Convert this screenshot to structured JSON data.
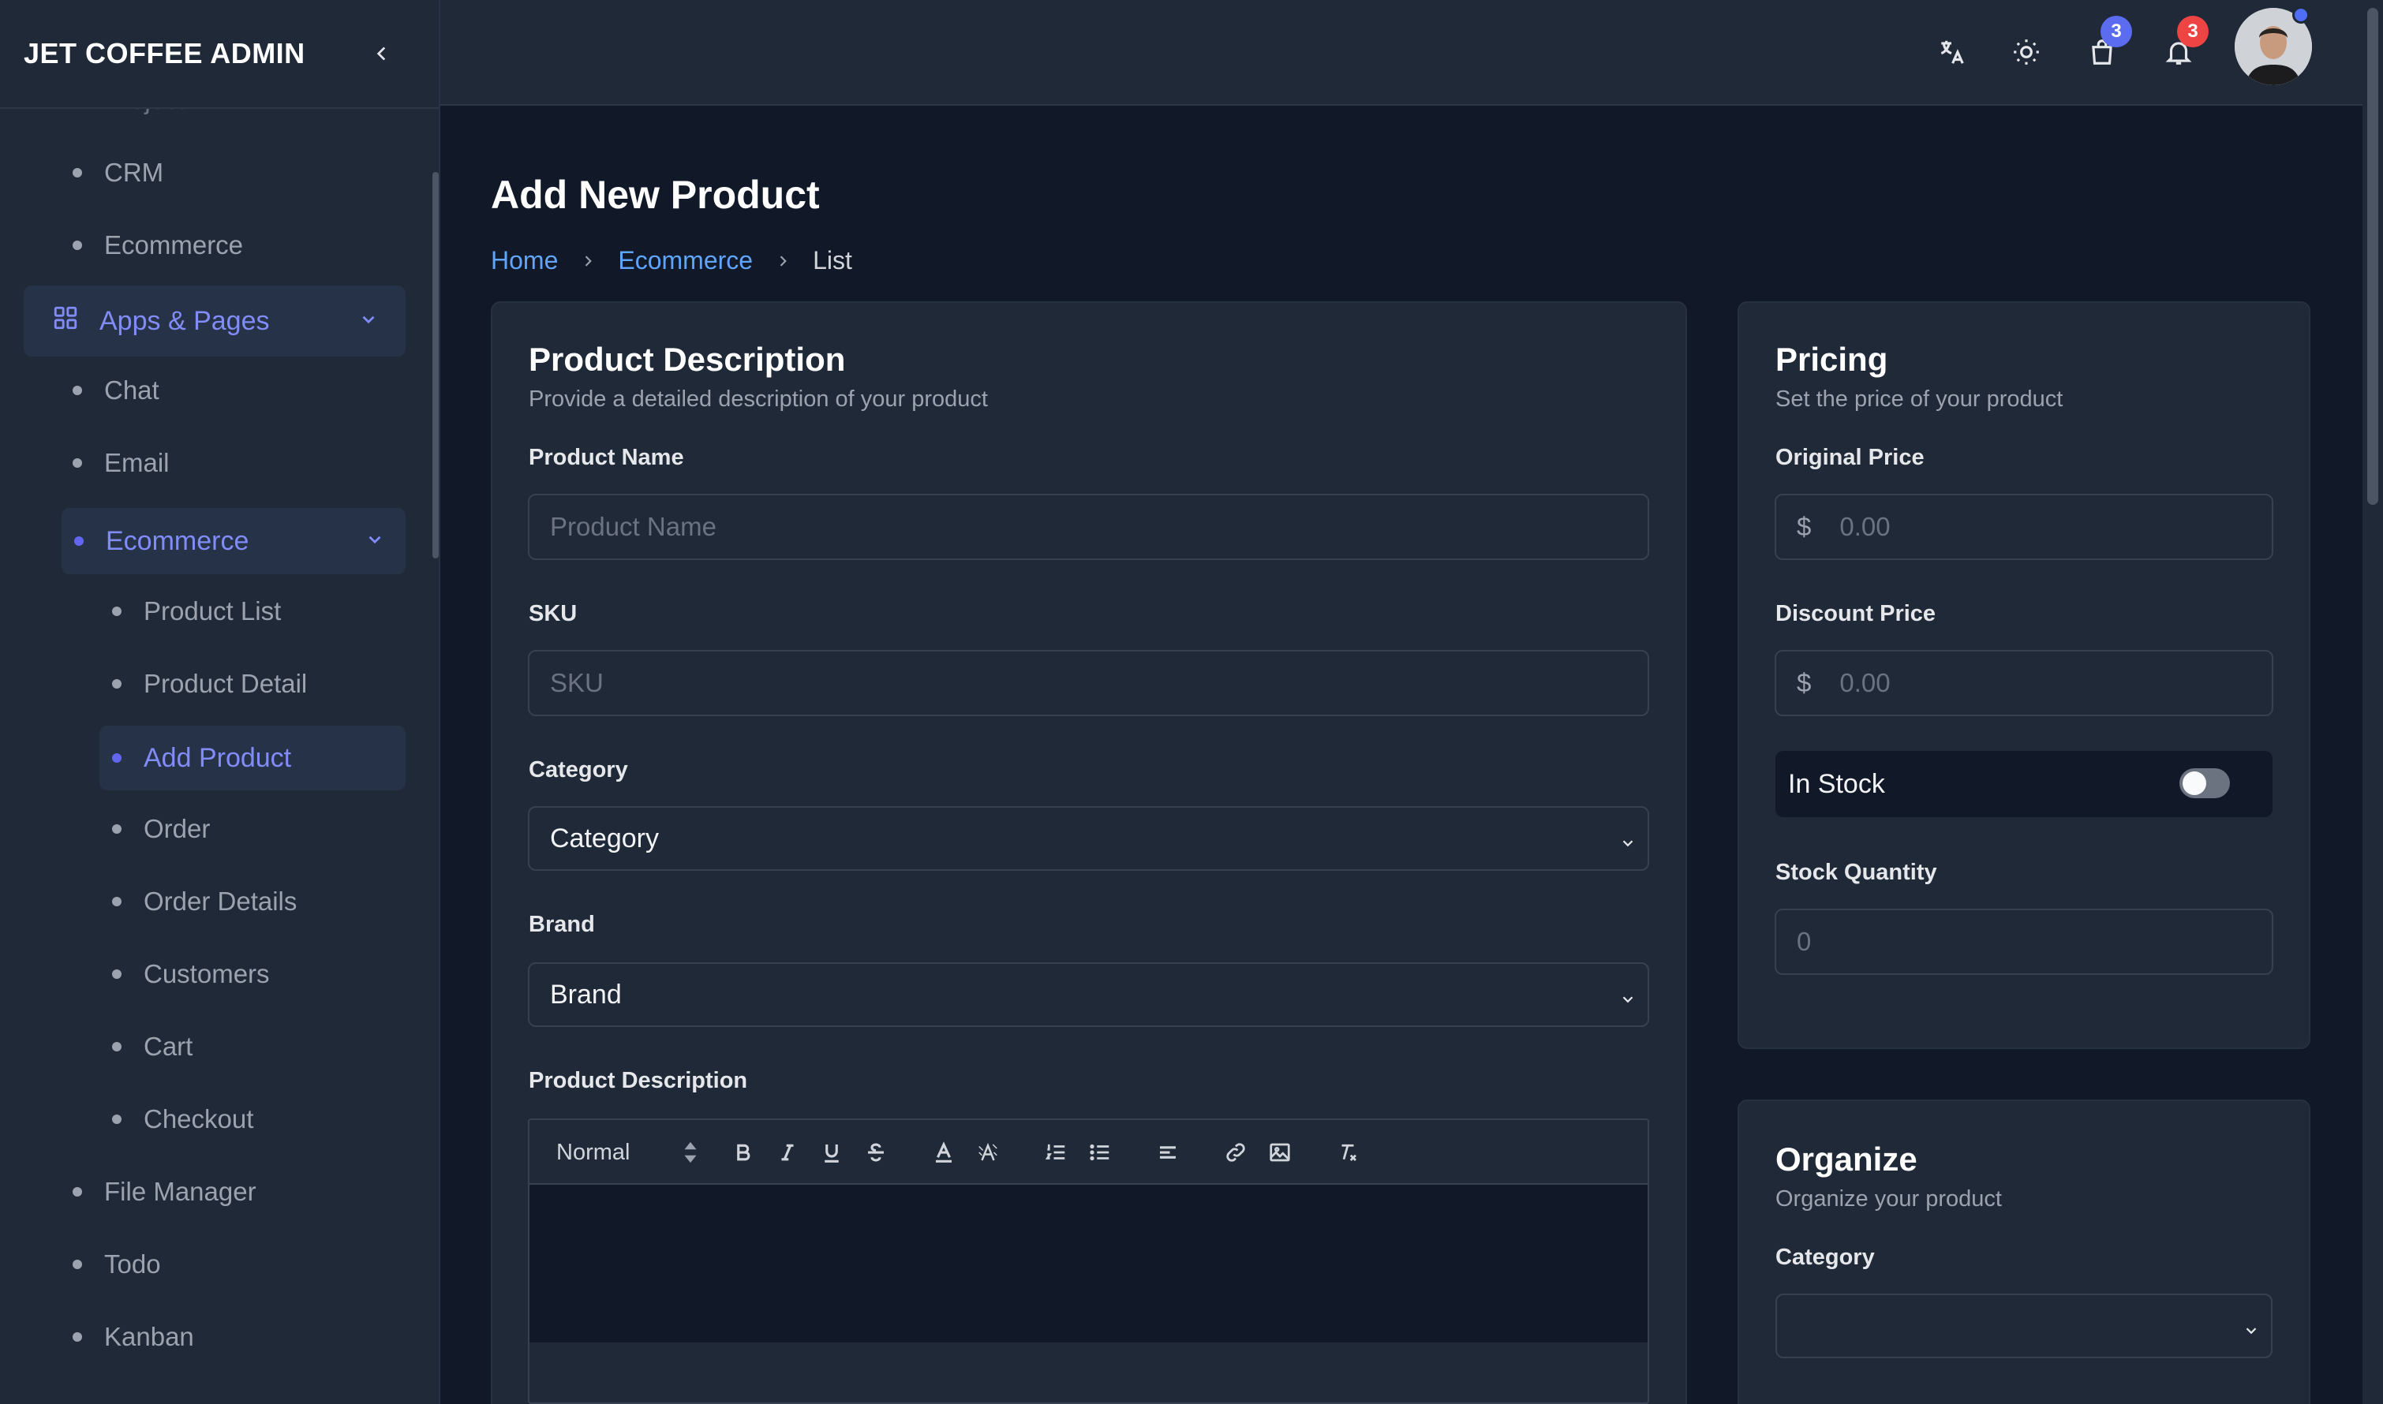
{
  "app": {
    "title": "JET COFFEE ADMIN"
  },
  "sidebar": {
    "cut_item": "Project",
    "items": [
      {
        "label": "CRM"
      },
      {
        "label": "Ecommerce"
      }
    ],
    "group": {
      "label": "Apps & Pages"
    },
    "apps": [
      {
        "label": "Chat"
      },
      {
        "label": "Email"
      }
    ],
    "ecommerce": {
      "label": "Ecommerce",
      "children": [
        {
          "label": "Product List"
        },
        {
          "label": "Product Detail"
        },
        {
          "label": "Add Product"
        },
        {
          "label": "Order"
        },
        {
          "label": "Order Details"
        },
        {
          "label": "Customers"
        },
        {
          "label": "Cart"
        },
        {
          "label": "Checkout"
        }
      ]
    },
    "after": [
      {
        "label": "File Manager"
      },
      {
        "label": "Todo"
      },
      {
        "label": "Kanban"
      }
    ]
  },
  "topbar": {
    "icons": [
      "translate-icon",
      "sun-icon",
      "cart-icon",
      "bell-icon"
    ],
    "cart_badge": "3",
    "notification_badge": "3",
    "accent": "#5b6cf0",
    "danger": "#ef4444"
  },
  "page": {
    "title": "Add New Product",
    "breadcrumb": [
      "Home",
      "Ecommerce",
      "List"
    ]
  },
  "description_card": {
    "title": "Product Description",
    "subtitle": "Provide a detailed description of your product",
    "product_name_label": "Product Name",
    "product_name_placeholder": "Product Name",
    "sku_label": "SKU",
    "sku_placeholder": "SKU",
    "category_label": "Category",
    "category_value": "Category",
    "brand_label": "Brand",
    "brand_value": "Brand",
    "description_label": "Product Description",
    "editor_size": "Normal"
  },
  "pricing_card": {
    "title": "Pricing",
    "subtitle": "Set the price of your product",
    "original_label": "Original Price",
    "original_placeholder": "0.00",
    "discount_label": "Discount Price",
    "discount_placeholder": "0.00",
    "currency": "$",
    "in_stock_label": "In Stock",
    "in_stock": false,
    "stock_qty_label": "Stock Quantity",
    "stock_qty_placeholder": "0"
  },
  "organize_card": {
    "title": "Organize",
    "subtitle": "Organize your product",
    "category_label": "Category",
    "category_value": ""
  }
}
